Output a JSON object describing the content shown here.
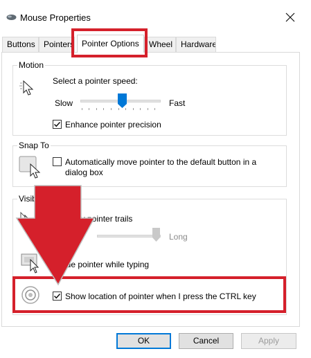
{
  "window": {
    "title": "Mouse Properties"
  },
  "tabs": [
    {
      "label": "Buttons",
      "active": false
    },
    {
      "label": "Pointers",
      "active": false
    },
    {
      "label": "Pointer Options",
      "active": true
    },
    {
      "label": "Wheel",
      "active": false
    },
    {
      "label": "Hardware",
      "active": false
    }
  ],
  "motion": {
    "group_label": "Motion",
    "speed_label": "Select a pointer speed:",
    "slow_label": "Slow",
    "fast_label": "Fast",
    "speed_value": 0.5,
    "enhance_precision_label": "Enhance pointer precision",
    "enhance_precision_checked": true
  },
  "snap_to": {
    "group_label": "Snap To",
    "snap_label_line1": "Automatically move pointer to the default button in a",
    "snap_label_line2": "dialog box",
    "snap_checked": false
  },
  "visibility": {
    "group_label": "Visibi",
    "trails_label": "ay pointer trails",
    "trails_checked": false,
    "long_label": "Long",
    "hide_typing_label": "ide pointer while typing",
    "hide_typing_checked": true,
    "ctrl_location_label": "Show location of pointer when I press the CTRL key",
    "ctrl_location_checked": true
  },
  "buttons": {
    "ok": "OK",
    "cancel": "Cancel",
    "apply": "Apply"
  },
  "colors": {
    "highlight": "#d5202b",
    "accent": "#0078d7"
  },
  "icons": [
    "mouse-icon",
    "close-icon",
    "pointer-speed-icon",
    "snap-to-icon",
    "pointer-trails-icon",
    "hide-pointer-icon",
    "pointer-location-icon",
    "red-down-arrow"
  ]
}
